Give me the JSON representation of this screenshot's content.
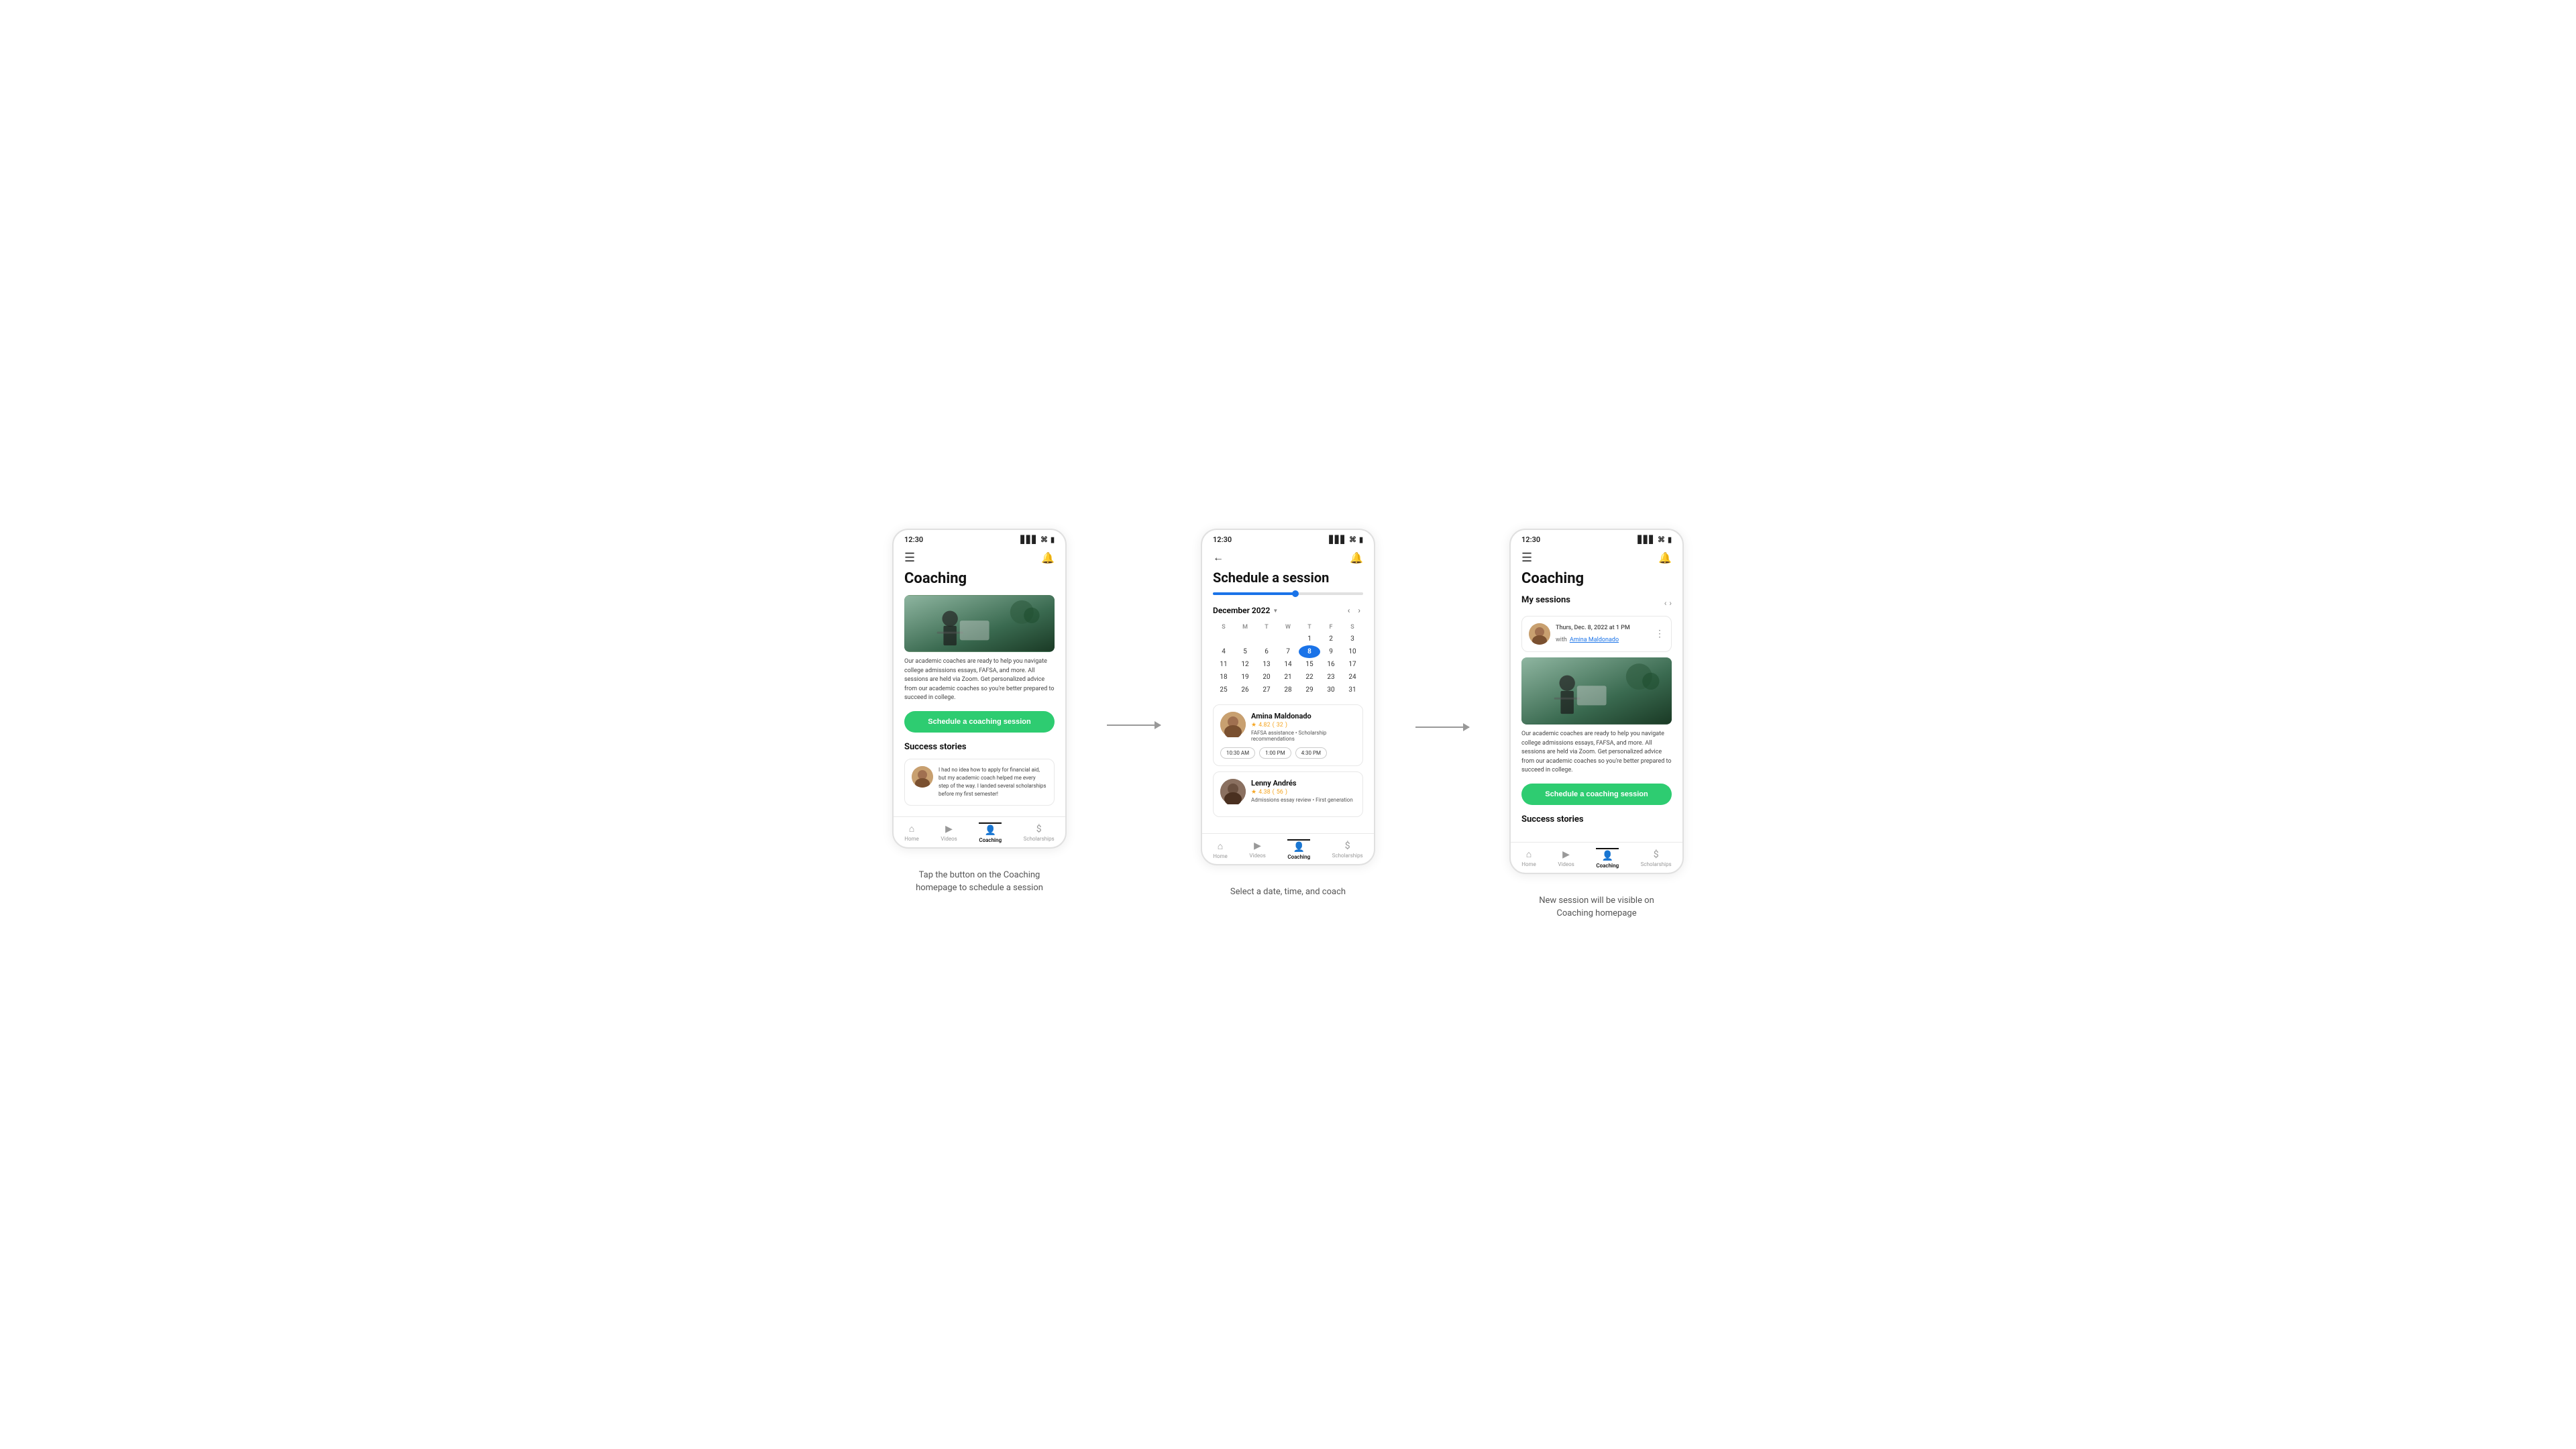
{
  "screens": [
    {
      "id": "screen1",
      "status_time": "12:30",
      "title": "Coaching",
      "description": "Our academic coaches are ready to help you navigate college admissions essays, FAFSA, and more. All sessions are held via Zoom. Get personalized advice from our academic coaches so you're better prepared to succeed in college.",
      "schedule_btn": "Schedule a coaching session",
      "success_title": "Success stories",
      "success_quote": "I had no idea how to apply for financial aid, but my academic coach helped me every step of the way. I landed several scholarships before my first semester!",
      "nav_items": [
        "Home",
        "Videos",
        "Coaching",
        "Scholarships"
      ],
      "active_nav": 2
    },
    {
      "id": "screen2",
      "status_time": "12:30",
      "title": "Schedule a session",
      "month": "December 2022",
      "progress_pct": 55,
      "days_header": [
        "S",
        "M",
        "T",
        "W",
        "T",
        "F",
        "S"
      ],
      "calendar_rows": [
        [
          "",
          "",
          "",
          "",
          "1",
          "2",
          "3"
        ],
        [
          "4",
          "5",
          "6",
          "7",
          "8",
          "9",
          "10"
        ],
        [
          "11",
          "12",
          "13",
          "14",
          "15",
          "16",
          "17"
        ],
        [
          "18",
          "19",
          "20",
          "21",
          "22",
          "23",
          "24"
        ],
        [
          "25",
          "26",
          "27",
          "28",
          "29",
          "30",
          "31"
        ]
      ],
      "selected_day": "8",
      "coaches": [
        {
          "name": "Amina Maldonado",
          "rating": "4.82",
          "rating_count": "32",
          "tags": "FAFSA assistance • Scholarship recommendations",
          "times": [
            "10:30 AM",
            "1:00 PM",
            "4:30 PM"
          ]
        },
        {
          "name": "Lenny Andrés",
          "rating": "4.38",
          "rating_count": "56",
          "tags": "Admissions essay review • First generation",
          "times": []
        }
      ],
      "nav_items": [
        "Home",
        "Videos",
        "Coaching",
        "Scholarships"
      ],
      "active_nav": 2
    },
    {
      "id": "screen3",
      "status_time": "12:30",
      "title": "Coaching",
      "my_sessions_title": "My sessions",
      "session_date": "Thurs, Dec. 8, 2022 at 1 PM",
      "session_with": "with",
      "session_coach": "Amina Maldonado",
      "description": "Our academic coaches are ready to help you navigate college admissions essays, FAFSA, and more. All sessions are held via Zoom. Get personalized advice from our academic coaches so you're better prepared to succeed in college.",
      "schedule_btn": "Schedule a coaching session",
      "success_title": "Success stories",
      "nav_items": [
        "Home",
        "Videos",
        "Coaching",
        "Scholarships"
      ],
      "active_nav": 2
    }
  ],
  "captions": [
    "Tap the button on the Coaching\nhomepage to schedule a session",
    "Select a date, time, and coach",
    "New session will be visible on\nCoaching homepage"
  ],
  "arrows": [
    "→",
    "→"
  ]
}
